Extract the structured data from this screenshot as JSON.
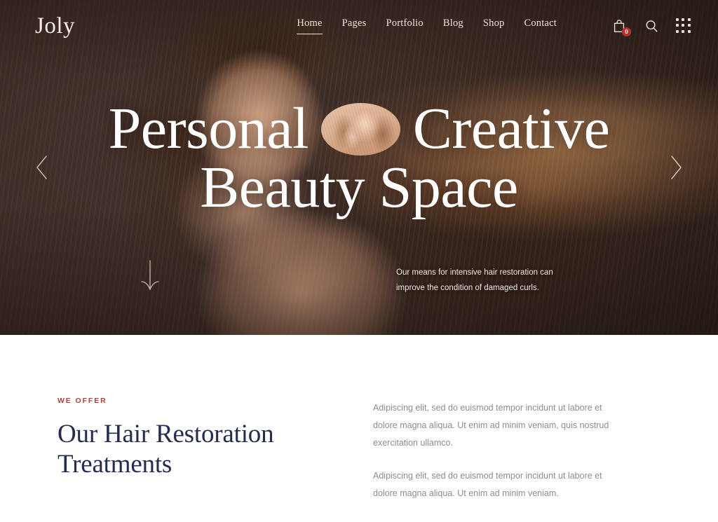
{
  "site": {
    "logo": "Joly"
  },
  "header": {
    "nav": [
      {
        "label": "Home",
        "active": true
      },
      {
        "label": "Pages",
        "active": false
      },
      {
        "label": "Portfolio",
        "active": false
      },
      {
        "label": "Blog",
        "active": false
      },
      {
        "label": "Shop",
        "active": false
      },
      {
        "label": "Contact",
        "active": false
      }
    ],
    "icons": {
      "cart": "shopping-bag-icon",
      "cart_count": "0",
      "search": "search-icon",
      "grid": "grid-menu-icon"
    }
  },
  "hero": {
    "title_line1_before": "Personal",
    "title_line1_after": "Creative",
    "title_line2": "Beauty Space",
    "caption": "Our means for intensive hair restoration can improve the condition of damaged curls.",
    "prev_arrow": "chevron-left-icon",
    "next_arrow": "chevron-right-icon",
    "scroll_hint": "arrow-down-icon",
    "inset_portrait": "oval-portrait-image"
  },
  "offer": {
    "eyebrow": "WE OFFER",
    "title": "Our Hair Restoration Treatments",
    "paragraphs": [
      "Adipiscing elit, sed do euismod tempor incidunt ut labore et dolore magna aliqua. Ut enim ad minim veniam, quis nostrud exercitation ullamco.",
      "Adipiscing elit, sed do euismod tempor incidunt ut labore et dolore magna aliqua. Ut enim ad minim veniam."
    ]
  },
  "colors": {
    "hero_bg": "#3e2f2b",
    "accent_red": "#b0413a",
    "badge_red": "#b53227",
    "heading_navy": "#232c52",
    "body_gray": "#8d8d92",
    "cream": "#f6ece4"
  }
}
